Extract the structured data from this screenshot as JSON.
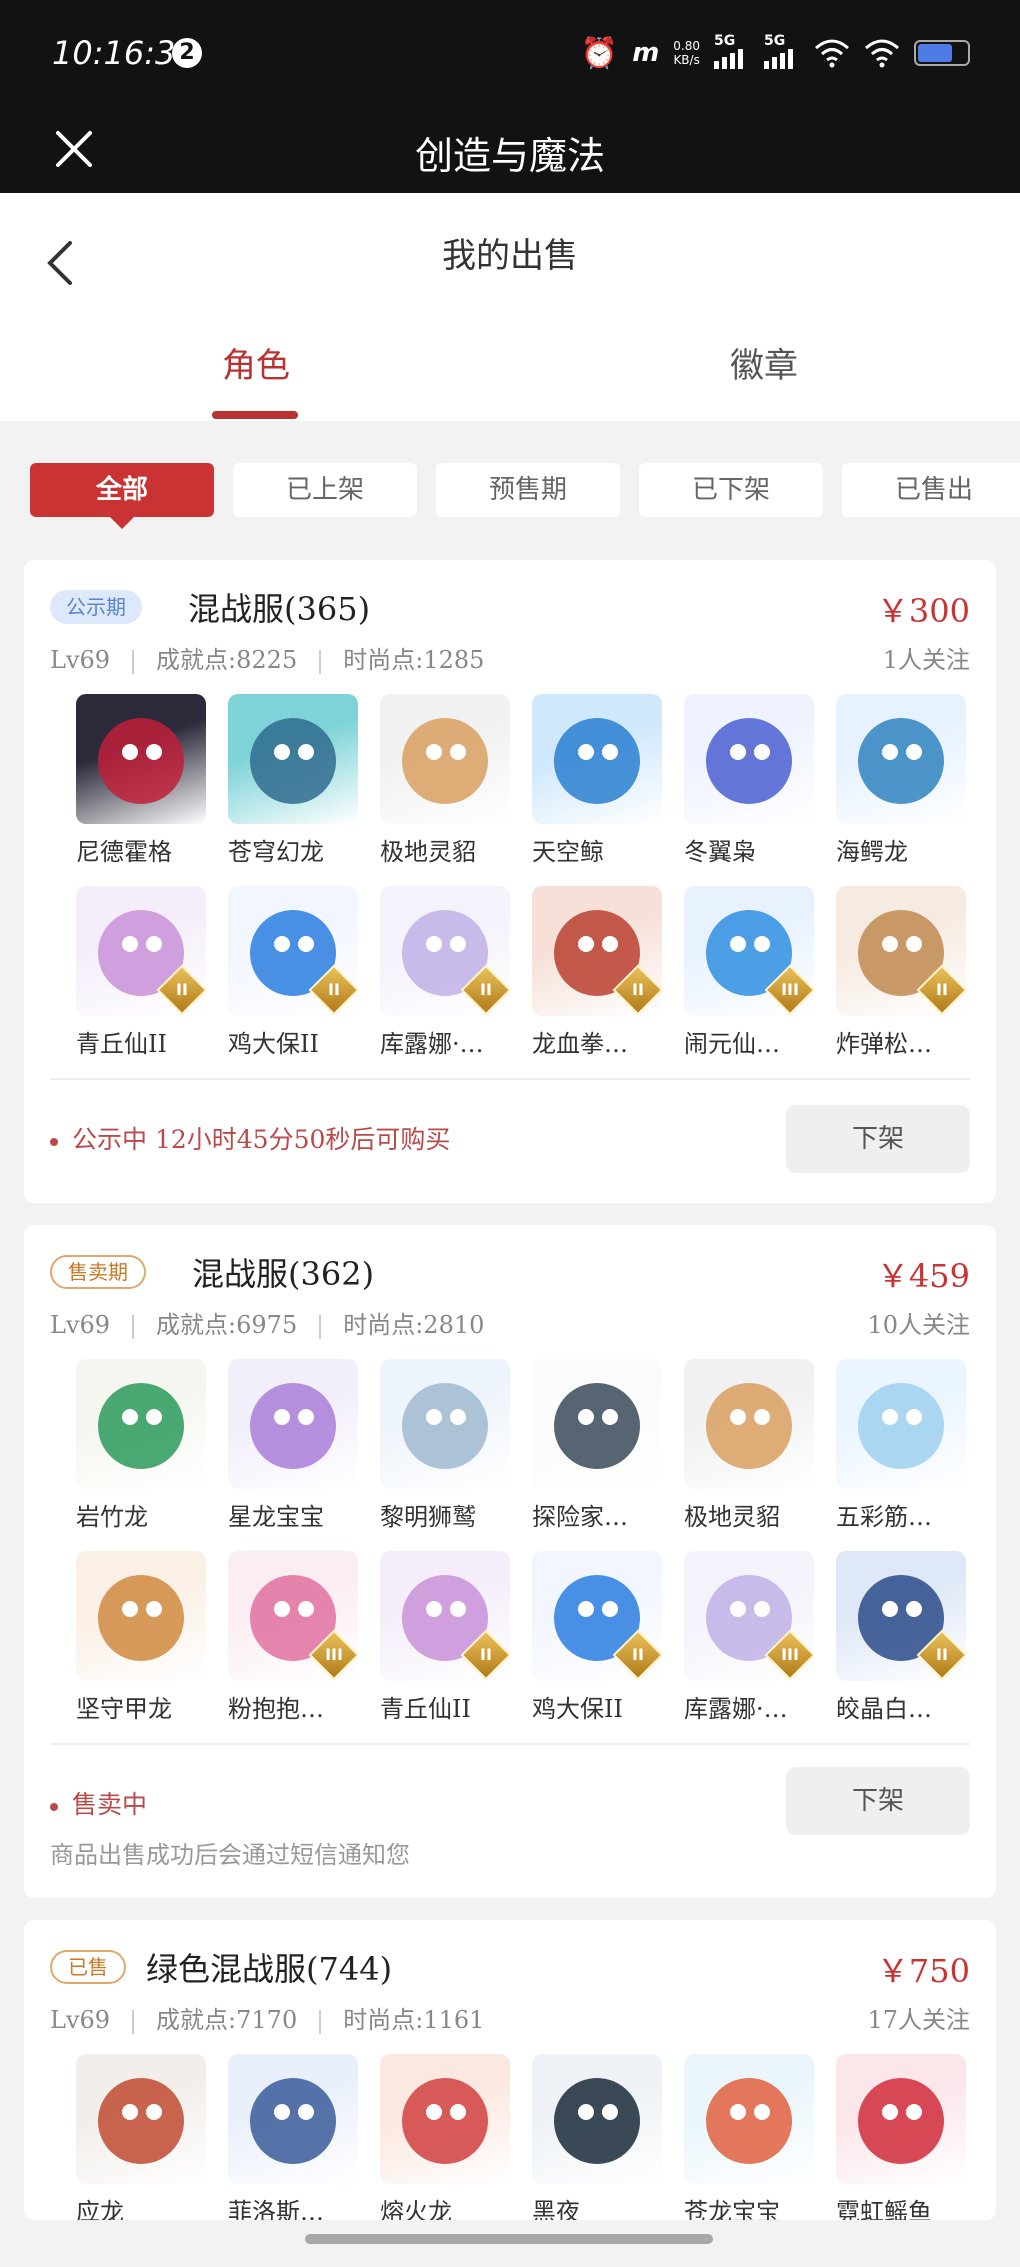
{
  "status_bar": {
    "time": "10:16:31",
    "notification_count": "2",
    "net_speed_value": "0.80",
    "net_speed_unit": "KB/s",
    "signal_1": "5G",
    "signal_2": "5G",
    "battery_level": 0.7
  },
  "app": {
    "title": "创造与魔法"
  },
  "page": {
    "title": "我的出售"
  },
  "tabs": [
    {
      "label": "角色",
      "active": true
    },
    {
      "label": "徽章",
      "active": false
    }
  ],
  "filters": [
    {
      "label": "全部",
      "active": true
    },
    {
      "label": "已上架",
      "active": false
    },
    {
      "label": "预售期",
      "active": false
    },
    {
      "label": "已下架",
      "active": false
    },
    {
      "label": "已售出",
      "active": false
    }
  ],
  "listings": [
    {
      "status_tag": "公示期",
      "server": "混战服(365)",
      "price": "￥300",
      "followers": "1人关注",
      "level": "Lv69",
      "achievement": "成就点:8225",
      "fashion": "时尚点:1285",
      "pets": [
        {
          "name": "尼德霍格",
          "icon": "dark-dragon",
          "rank": ""
        },
        {
          "name": "苍穹幻龙",
          "icon": "teal-dragon",
          "rank": ""
        },
        {
          "name": "极地灵貂",
          "icon": "white-fox",
          "rank": ""
        },
        {
          "name": "天空鲸",
          "icon": "sky-whale",
          "rank": ""
        },
        {
          "name": "冬翼枭",
          "icon": "snow-owl",
          "rank": ""
        },
        {
          "name": "海鳄龙",
          "icon": "sea-dragon",
          "rank": ""
        },
        {
          "name": "青丘仙II",
          "icon": "fox-fairy",
          "rank": "II"
        },
        {
          "name": "鸡大保II",
          "icon": "blue-bird",
          "rank": "II"
        },
        {
          "name": "库露娜·…",
          "icon": "white-fairy",
          "rank": "II"
        },
        {
          "name": "龙血拳…",
          "icon": "red-beast",
          "rank": "II"
        },
        {
          "name": "闹元仙…",
          "icon": "blue-dog",
          "rank": "III"
        },
        {
          "name": "炸弹松…",
          "icon": "squirrel",
          "rank": "II"
        }
      ],
      "status_text": "公示中 12小时45分50秒后可购买",
      "sub_text": "",
      "action_label": "下架"
    },
    {
      "status_tag": "售卖期",
      "server": "混战服(362)",
      "price": "￥459",
      "followers": "10人关注",
      "level": "Lv69",
      "achievement": "成就点:6975",
      "fashion": "时尚点:2810",
      "pets": [
        {
          "name": "岩竹龙",
          "icon": "bamboo-dragon",
          "rank": ""
        },
        {
          "name": "星龙宝宝",
          "icon": "star-dragon",
          "rank": ""
        },
        {
          "name": "黎明狮鹫",
          "icon": "griffin",
          "rank": ""
        },
        {
          "name": "探险家…",
          "icon": "shovel",
          "rank": ""
        },
        {
          "name": "极地灵貂",
          "icon": "white-fox",
          "rank": ""
        },
        {
          "name": "五彩筋…",
          "icon": "cloud",
          "rank": ""
        },
        {
          "name": "坚守甲龙",
          "icon": "armor-dragon",
          "rank": ""
        },
        {
          "name": "粉抱抱…",
          "icon": "pink-bear",
          "rank": "III"
        },
        {
          "name": "青丘仙II",
          "icon": "fox-fairy",
          "rank": "II"
        },
        {
          "name": "鸡大保II",
          "icon": "blue-bird",
          "rank": "II"
        },
        {
          "name": "库露娜·…",
          "icon": "white-fairy",
          "rank": "III"
        },
        {
          "name": "皎晶白…",
          "icon": "white-tiger",
          "rank": "II"
        }
      ],
      "status_text": "售卖中",
      "sub_text": "商品出售成功后会通过短信通知您",
      "action_label": "下架"
    },
    {
      "status_tag": "已售",
      "server": "绿色混战服(744)",
      "price": "￥750",
      "followers": "17人关注",
      "level": "Lv69",
      "achievement": "成就点:7170",
      "fashion": "时尚点:1161",
      "pets": [
        {
          "name": "应龙",
          "icon": "ying-dragon",
          "rank": ""
        },
        {
          "name": "菲洛斯…",
          "icon": "ice-dragon",
          "rank": ""
        },
        {
          "name": "熔火龙",
          "icon": "fire-dragon",
          "rank": ""
        },
        {
          "name": "黑夜",
          "icon": "night-fury",
          "rank": ""
        },
        {
          "name": "苍龙宝宝",
          "icon": "baby-dragon",
          "rank": ""
        },
        {
          "name": "霓虹鳐鱼",
          "icon": "neon-ray",
          "rank": ""
        }
      ]
    }
  ],
  "colors": {
    "accent": "#c93333",
    "status_bar_bg": "#121212",
    "page_bg": "#f2f2f2"
  }
}
